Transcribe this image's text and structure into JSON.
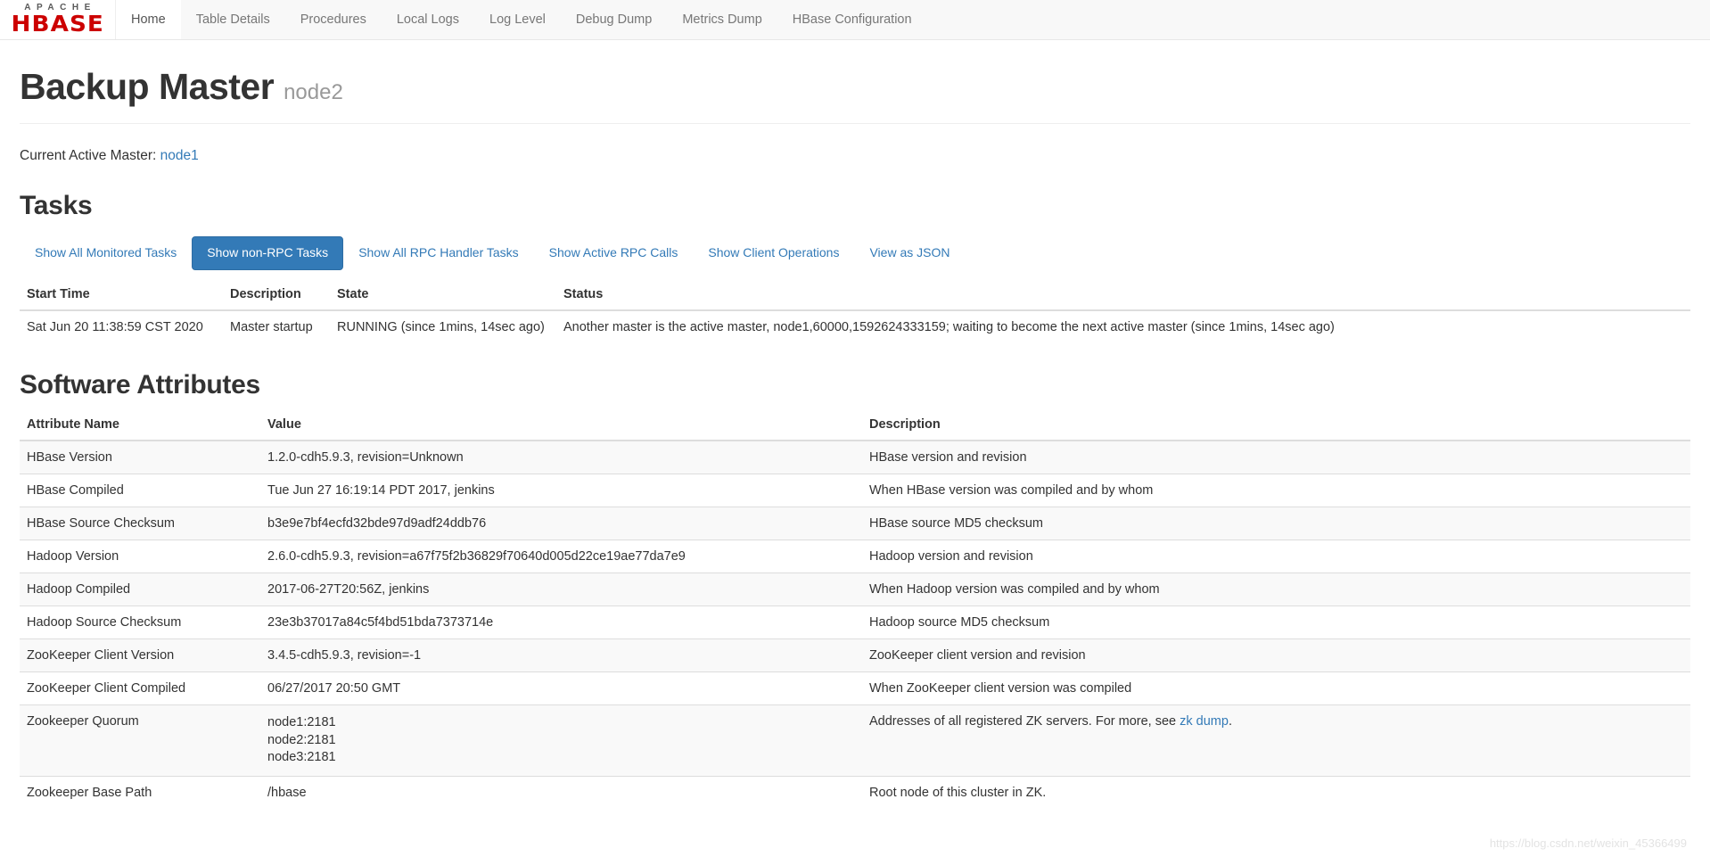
{
  "navbar": {
    "brand": {
      "top": "APACHE",
      "bottom": "HBASE"
    },
    "items": [
      {
        "label": "Home",
        "active": true
      },
      {
        "label": "Table Details",
        "active": false
      },
      {
        "label": "Procedures",
        "active": false
      },
      {
        "label": "Local Logs",
        "active": false
      },
      {
        "label": "Log Level",
        "active": false
      },
      {
        "label": "Debug Dump",
        "active": false
      },
      {
        "label": "Metrics Dump",
        "active": false
      },
      {
        "label": "HBase Configuration",
        "active": false
      }
    ]
  },
  "header": {
    "title": "Backup Master",
    "subtitle": "node2"
  },
  "active_master": {
    "label": "Current Active Master:",
    "value": "node1"
  },
  "tasks": {
    "heading": "Tasks",
    "buttons": [
      {
        "label": "Show All Monitored Tasks",
        "active": false
      },
      {
        "label": "Show non-RPC Tasks",
        "active": true
      },
      {
        "label": "Show All RPC Handler Tasks",
        "active": false
      },
      {
        "label": "Show Active RPC Calls",
        "active": false
      },
      {
        "label": "Show Client Operations",
        "active": false
      },
      {
        "label": "View as JSON",
        "active": false
      }
    ],
    "columns": [
      "Start Time",
      "Description",
      "State",
      "Status"
    ],
    "rows": [
      {
        "start_time": "Sat Jun 20 11:38:59 CST 2020",
        "description": "Master startup",
        "state": "RUNNING (since 1mins, 14sec ago)",
        "status": "Another master is the active master, node1,60000,1592624333159; waiting to become the next active master (since 1mins, 14sec ago)"
      }
    ]
  },
  "software_attributes": {
    "heading": "Software Attributes",
    "columns": [
      "Attribute Name",
      "Value",
      "Description"
    ],
    "rows": [
      {
        "name": "HBase Version",
        "value": "1.2.0-cdh5.9.3, revision=Unknown",
        "description": "HBase version and revision"
      },
      {
        "name": "HBase Compiled",
        "value": "Tue Jun 27 16:19:14 PDT 2017, jenkins",
        "description": "When HBase version was compiled and by whom"
      },
      {
        "name": "HBase Source Checksum",
        "value": "b3e9e7bf4ecfd32bde97d9adf24ddb76",
        "description": "HBase source MD5 checksum"
      },
      {
        "name": "Hadoop Version",
        "value": "2.6.0-cdh5.9.3, revision=a67f75f2b36829f70640d005d22ce19ae77da7e9",
        "description": "Hadoop version and revision"
      },
      {
        "name": "Hadoop Compiled",
        "value": "2017-06-27T20:56Z, jenkins",
        "description": "When Hadoop version was compiled and by whom"
      },
      {
        "name": "Hadoop Source Checksum",
        "value": "23e3b37017a84c5f4bd51bda7373714e",
        "description": "Hadoop source MD5 checksum"
      },
      {
        "name": "ZooKeeper Client Version",
        "value": "3.4.5-cdh5.9.3, revision=-1",
        "description": "ZooKeeper client version and revision"
      },
      {
        "name": "ZooKeeper Client Compiled",
        "value": "06/27/2017 20:50 GMT",
        "description": "When ZooKeeper client version was compiled"
      },
      {
        "name": "Zookeeper Quorum",
        "value_lines": [
          "node1:2181",
          "node2:2181",
          "node3:2181"
        ],
        "description_prefix": "Addresses of all registered ZK servers. For more, see ",
        "description_link": "zk dump",
        "description_suffix": "."
      },
      {
        "name": "Zookeeper Base Path",
        "value": "/hbase",
        "description": "Root node of this cluster in ZK."
      }
    ]
  },
  "watermark": "https://blog.csdn.net/weixin_45366499"
}
